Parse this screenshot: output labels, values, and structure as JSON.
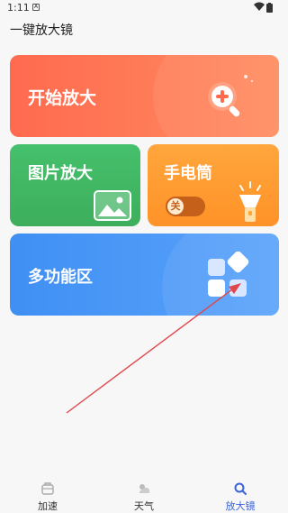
{
  "status_bar": {
    "time": "1:11",
    "app_icon_text": "A"
  },
  "app": {
    "title": "一键放大镜"
  },
  "cards": {
    "start_magnify": {
      "label": "开始放大"
    },
    "picture_magnify": {
      "label": "图片放大"
    },
    "flashlight": {
      "label": "手电筒",
      "toggle_text": "关"
    },
    "multi_function": {
      "label": "多功能区"
    }
  },
  "tabs": [
    {
      "label": "加速",
      "icon": "speedup-icon",
      "active": false
    },
    {
      "label": "天气",
      "icon": "weather-icon",
      "active": false
    },
    {
      "label": "放大镜",
      "icon": "magnifier-icon",
      "active": true
    }
  ],
  "colors": {
    "start_card": "#ff6a4f",
    "picture_card": "#45c06c",
    "flashlight_card": "#ffa63c",
    "multi_card": "#3f8ff4",
    "active_tab": "#3b63d9",
    "annotation_arrow": "#e0474c"
  }
}
